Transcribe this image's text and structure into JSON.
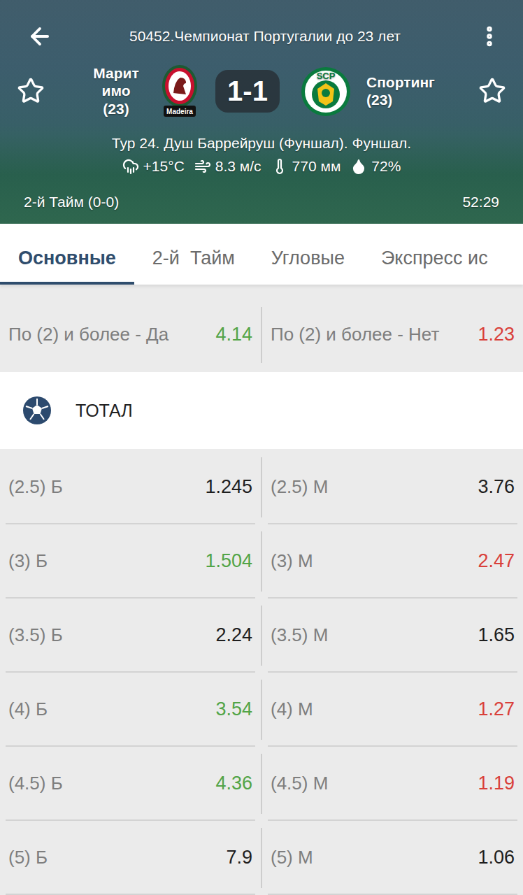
{
  "header": {
    "title": "50452.Чемпионат Португалии до 23 лет",
    "home": {
      "name": "Маритимо (23)",
      "logo_caption": "Madeira",
      "favorite": false
    },
    "away": {
      "name": "Спортинг (23)",
      "logo_caption": "SCP",
      "favorite": false
    },
    "score": "1-1",
    "round": "Тур 24. Душ Баррейруш (Фуншал). Фуншал.",
    "weather": [
      {
        "kind": "rain",
        "text": "+15°C"
      },
      {
        "kind": "wind",
        "text": "8.3 м/с"
      },
      {
        "kind": "pressure",
        "text": "770 мм"
      },
      {
        "kind": "humidity",
        "text": "72%"
      }
    ],
    "period": "2-й Тайм (0-0)",
    "clock": "52:29"
  },
  "tabs": [
    {
      "label": "Основные",
      "selected": true
    },
    {
      "label": "2-й  Тайм",
      "selected": false
    },
    {
      "label": "Угловые",
      "selected": false
    },
    {
      "label": "Экспресс ис",
      "selected": false
    }
  ],
  "highlight": {
    "left": {
      "label": "По (2) и более - Да",
      "price": "4.14",
      "trend": "up"
    },
    "right": {
      "label": "По (2) и более - Нет",
      "price": "1.23",
      "trend": "down"
    }
  },
  "total": {
    "title": "ТОТАЛ",
    "rows": [
      {
        "over": {
          "label": "(2.5) Б",
          "price": "1.245",
          "trend": "none"
        },
        "under": {
          "label": "(2.5) М",
          "price": "3.76",
          "trend": "none"
        }
      },
      {
        "over": {
          "label": "(3) Б",
          "price": "1.504",
          "trend": "up"
        },
        "under": {
          "label": "(3) М",
          "price": "2.47",
          "trend": "down"
        }
      },
      {
        "over": {
          "label": "(3.5) Б",
          "price": "2.24",
          "trend": "none"
        },
        "under": {
          "label": "(3.5) М",
          "price": "1.65",
          "trend": "none"
        }
      },
      {
        "over": {
          "label": "(4) Б",
          "price": "3.54",
          "trend": "up"
        },
        "under": {
          "label": "(4) М",
          "price": "1.27",
          "trend": "down"
        }
      },
      {
        "over": {
          "label": "(4.5) Б",
          "price": "4.36",
          "trend": "up"
        },
        "under": {
          "label": "(4.5) М",
          "price": "1.19",
          "trend": "down"
        }
      },
      {
        "over": {
          "label": "(5) Б",
          "price": "7.9",
          "trend": "none"
        },
        "under": {
          "label": "(5) М",
          "price": "1.06",
          "trend": "none"
        }
      }
    ]
  }
}
